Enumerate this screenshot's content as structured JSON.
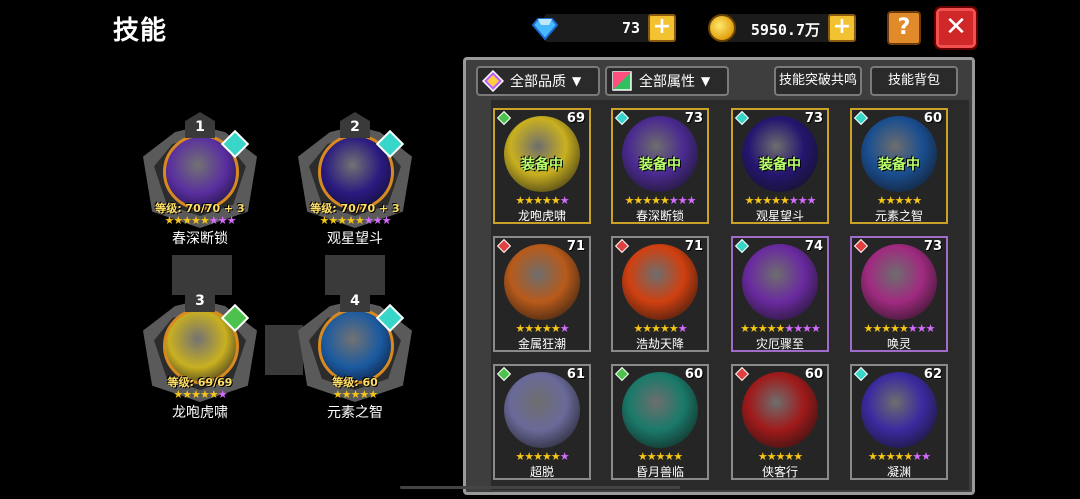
{
  "header": {
    "title": "技能"
  },
  "resources": {
    "gems": {
      "amount": "73",
      "icon": "diamond-icon",
      "plus": "+"
    },
    "coins": {
      "amount": "5950.7万",
      "icon": "coin-icon",
      "plus": "+"
    }
  },
  "buttons": {
    "help": "?",
    "close": "✕"
  },
  "equipped": [
    {
      "num": "1",
      "level": "等级: 70/70 + 3",
      "stars": "★★★★★",
      "stars_extra": "★★★",
      "name": "春深断锁",
      "element_color": "#37d6c8",
      "orb_color": "#5a2ea0"
    },
    {
      "num": "2",
      "level": "等级: 70/70 + 3",
      "stars": "★★★★★",
      "stars_extra": "★★★",
      "name": "观星望斗",
      "element_color": "#37d6c8",
      "orb_color": "#2a1a80"
    },
    {
      "num": "3",
      "level": "等级: 69/69",
      "stars": "★★★★★",
      "stars_extra": "★",
      "name": "龙咆虎啸",
      "element_color": "#4cc24c",
      "orb_color": "#c9b020"
    },
    {
      "num": "4",
      "level": "等级: 60",
      "stars": "★★★★★",
      "stars_extra": "",
      "name": "元素之智",
      "element_color": "#37d6c8",
      "orb_color": "#1a5aa0"
    }
  ],
  "filters": {
    "quality": "全部品质",
    "attribute": "全部属性",
    "breakthrough": "技能突破共鸣",
    "bag": "技能背包"
  },
  "cards": [
    {
      "name": "龙咆虎啸",
      "level": "69",
      "tag": "装备中",
      "stars": "★★★★★",
      "stars_extra": "★",
      "element_color": "#4cc24c",
      "orb_color": "#c9b020"
    },
    {
      "name": "春深断锁",
      "level": "73",
      "tag": "装备中",
      "stars": "★★★★★",
      "stars_extra": "★★★",
      "element_color": "#37d6c8",
      "orb_color": "#4a2a90"
    },
    {
      "name": "观星望斗",
      "level": "73",
      "tag": "装备中",
      "stars": "★★★★★",
      "stars_extra": "★★★",
      "element_color": "#37d6c8",
      "orb_color": "#241670"
    },
    {
      "name": "元素之智",
      "level": "60",
      "tag": "装备中",
      "stars": "★★★★★",
      "stars_extra": "",
      "element_color": "#37d6c8",
      "orb_color": "#1a4e90"
    },
    {
      "name": "金属狂潮",
      "level": "71",
      "tag": "",
      "stars": "★★★★★",
      "stars_extra": "★",
      "element_color": "#e04040",
      "orb_color": "#b85a1a"
    },
    {
      "name": "浩劫天降",
      "level": "71",
      "tag": "",
      "stars": "★★★★★",
      "stars_extra": "★",
      "element_color": "#e04040",
      "orb_color": "#d04010"
    },
    {
      "name": "灾厄骤至",
      "level": "74",
      "tag": "",
      "stars": "★★★★★",
      "stars_extra": "★★★★",
      "element_color": "#37d6c8",
      "orb_color": "#6a2aa0"
    },
    {
      "name": "唤灵",
      "level": "73",
      "tag": "",
      "stars": "★★★★★",
      "stars_extra": "★★★",
      "element_color": "#e04040",
      "orb_color": "#a02a80"
    },
    {
      "name": "超脱",
      "level": "61",
      "tag": "",
      "stars": "★★★★★",
      "stars_extra": "★",
      "element_color": "#4cc24c",
      "orb_color": "#6a6a9a"
    },
    {
      "name": "昏月兽临",
      "level": "60",
      "tag": "",
      "stars": "★★★★★",
      "stars_extra": "",
      "element_color": "#4cc24c",
      "orb_color": "#1a7a6a"
    },
    {
      "name": "侠客行",
      "level": "60",
      "tag": "",
      "stars": "★★★★★",
      "stars_extra": "",
      "element_color": "#e04040",
      "orb_color": "#a01a1a"
    },
    {
      "name": "凝渊",
      "level": "62",
      "tag": "",
      "stars": "★★★★★",
      "stars_extra": "★★",
      "element_color": "#37d6c8",
      "orb_color": "#3a2aa0"
    }
  ]
}
